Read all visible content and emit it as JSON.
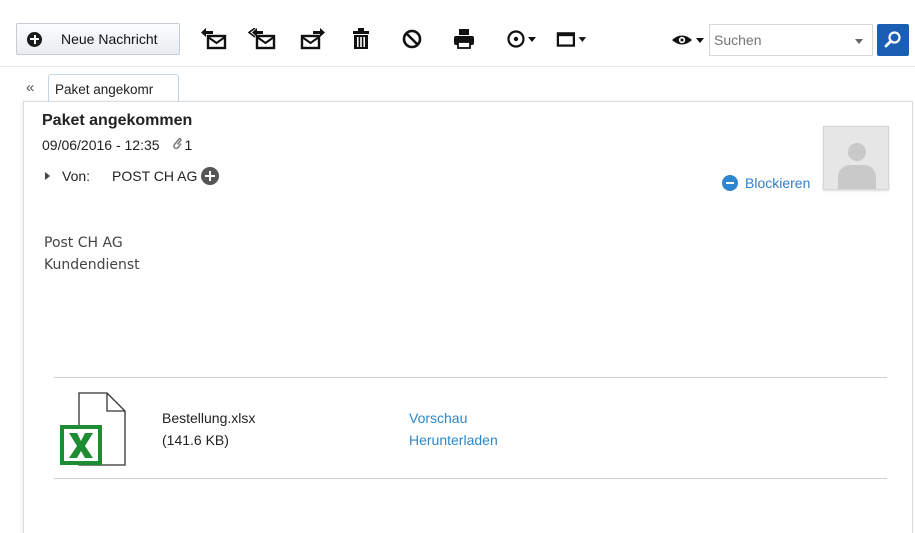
{
  "toolbar": {
    "new_message_label": "Neue Nachricht",
    "icons": [
      "reply-icon",
      "reply-all-icon",
      "forward-icon",
      "delete-icon",
      "spam-block-icon",
      "print-icon",
      "more-actions-icon",
      "view-options-icon"
    ]
  },
  "search": {
    "placeholder": "Suchen"
  },
  "tabs": [
    {
      "label": "Paket angekomr"
    }
  ],
  "message": {
    "subject": "Paket angekommen",
    "date": "09/06/2016 - 12:35",
    "attachment_count": "1",
    "from_label": "Von:",
    "sender": "POST CH AG",
    "block_label": "Blockieren",
    "body_lines": [
      "Post CH AG",
      "Kundendienst"
    ]
  },
  "attachment": {
    "file_name": "Bestellung.xlsx",
    "file_size": "(141.6 KB)",
    "preview_label": "Vorschau",
    "download_label": "Herunterladen"
  },
  "colors": {
    "accent": "#1a5fb4",
    "link": "#2f86c9",
    "excel_green": "#1e8c32"
  }
}
